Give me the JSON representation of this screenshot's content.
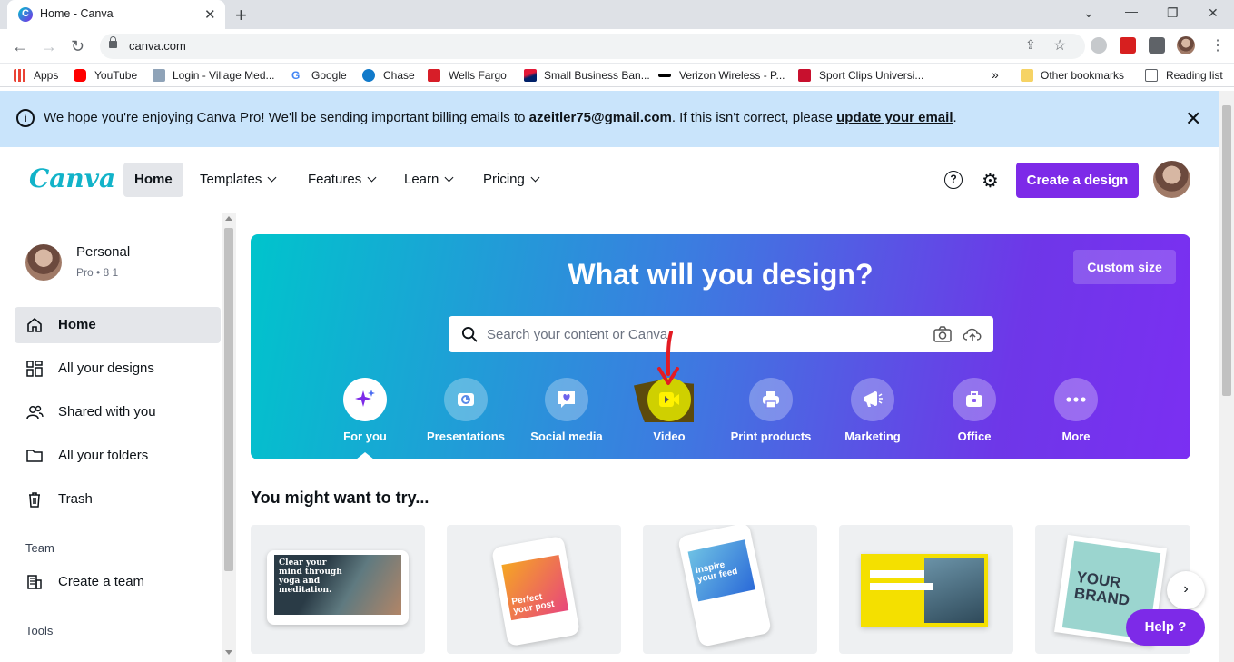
{
  "browser": {
    "tab_title": "Home - Canva",
    "url": "canva.com",
    "bookmarks": [
      {
        "label": "Apps"
      },
      {
        "label": "YouTube"
      },
      {
        "label": "Login - Village Med..."
      },
      {
        "label": "Google"
      },
      {
        "label": "Chase"
      },
      {
        "label": "Wells Fargo"
      },
      {
        "label": "Small Business Ban..."
      },
      {
        "label": "Verizon Wireless - P..."
      },
      {
        "label": "Sport Clips Universi..."
      }
    ],
    "overflow": "»",
    "other_bookmarks": "Other bookmarks",
    "reading_list": "Reading list"
  },
  "banner": {
    "text_before": "We hope you're enjoying Canva Pro! We'll be sending important billing emails to ",
    "email": "azeitler75@gmail.com",
    "text_middle": ". If this isn't correct, please ",
    "link": "update your email",
    "text_after": "."
  },
  "header": {
    "logo": "Canva",
    "nav": [
      {
        "label": "Home"
      },
      {
        "label": "Templates"
      },
      {
        "label": "Features"
      },
      {
        "label": "Learn"
      },
      {
        "label": "Pricing"
      }
    ],
    "help_glyph": "?",
    "create_button": "Create a design"
  },
  "sidebar": {
    "account_name": "Personal",
    "account_meta": "Pro • 8 1",
    "items": [
      {
        "label": "Home",
        "icon": "home-icon"
      },
      {
        "label": "All your designs",
        "icon": "grid-icon"
      },
      {
        "label": "Shared with you",
        "icon": "people-icon"
      },
      {
        "label": "All your folders",
        "icon": "folder-icon"
      },
      {
        "label": "Trash",
        "icon": "trash-icon"
      }
    ],
    "team_heading": "Team",
    "create_team": "Create a team",
    "tools_heading": "Tools"
  },
  "hero": {
    "title": "What will you design?",
    "custom_size": "Custom size",
    "search_placeholder": "Search your content or Canva",
    "categories": [
      {
        "label": "For you",
        "icon": "sparkle-icon"
      },
      {
        "label": "Presentations",
        "icon": "presentation-icon"
      },
      {
        "label": "Social media",
        "icon": "heart-chat-icon"
      },
      {
        "label": "Video",
        "icon": "video-camera-icon"
      },
      {
        "label": "Print products",
        "icon": "printer-icon"
      },
      {
        "label": "Marketing",
        "icon": "megaphone-icon"
      },
      {
        "label": "Office",
        "icon": "briefcase-icon"
      },
      {
        "label": "More",
        "icon": "more-icon"
      }
    ],
    "selected_category": "For you"
  },
  "suggestions": {
    "title": "You might want to try...",
    "card1_text": "Clear your mind through yoga and meditation.",
    "card2_text": "Perfect your post",
    "card3_text": "Inspire your feed",
    "card5_text": "YOUR BRAND"
  },
  "help_button": "Help  ?",
  "colors": {
    "accent": "#7d2ae8",
    "banner_bg": "#c9e4fb",
    "annotation_arrow": "#e31b23",
    "annotation_highlight": "#ffeb00"
  }
}
